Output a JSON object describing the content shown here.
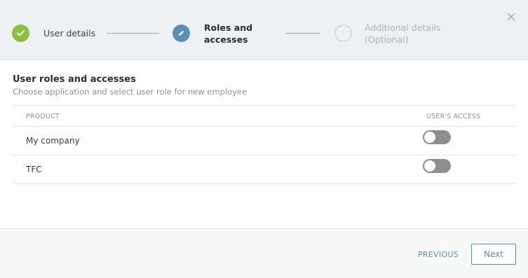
{
  "stepper": {
    "steps": [
      {
        "label": "User details",
        "status": "complete",
        "icon": "check-icon"
      },
      {
        "label_line1": "Roles and",
        "label_line2": "accesses",
        "status": "active",
        "icon": "pencil-icon"
      },
      {
        "label_line1": "Additional details",
        "label_line2": "(Optional)",
        "status": "pending"
      }
    ],
    "colors": {
      "complete": "#8dbf3f",
      "active": "#5b8fb1",
      "pending": "#d6dbdf"
    }
  },
  "section": {
    "title": "User roles and accesses",
    "subtitle": "Choose application and select user role for new employee"
  },
  "table": {
    "columns": {
      "product": "PRODUCT",
      "access": "USER'S ACCESS"
    },
    "rows": [
      {
        "product": "My company",
        "access_enabled": false
      },
      {
        "product": "TFC",
        "access_enabled": false
      }
    ]
  },
  "footer": {
    "previous_label": "PREVIOUS",
    "next_label": "Next"
  }
}
